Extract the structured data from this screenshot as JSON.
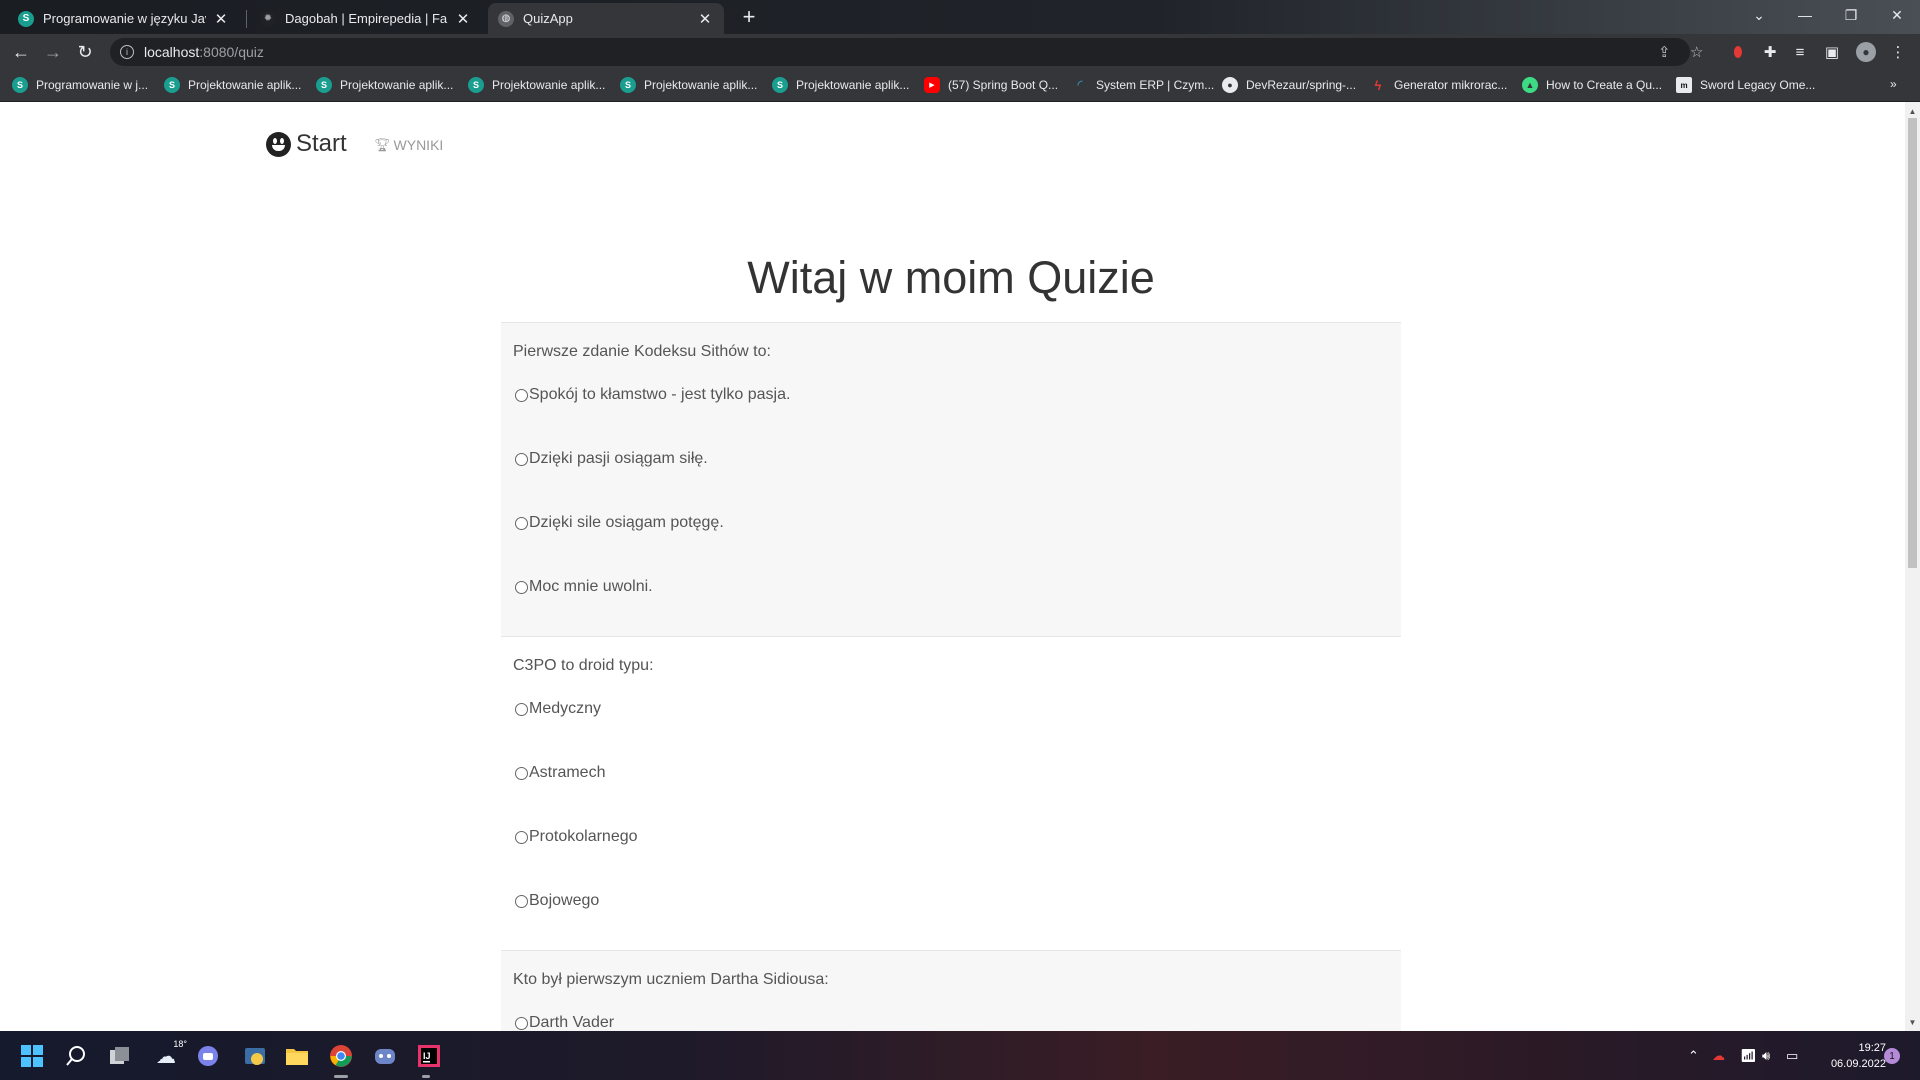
{
  "browser": {
    "tabs": [
      {
        "title": "Programowanie w języku Java [I]",
        "favicon": "s-favicon",
        "active": false
      },
      {
        "title": "Dagobah | Empirepedia | Fandom",
        "favicon": "fandom-favicon",
        "active": false
      },
      {
        "title": "QuizApp",
        "favicon": "globe-favicon",
        "active": true
      }
    ],
    "url_host": "localhost",
    "url_path": ":8080/quiz",
    "bookmarks": [
      {
        "label": "Programowanie w j...",
        "icon": "s-favicon"
      },
      {
        "label": "Projektowanie aplik...",
        "icon": "s-favicon"
      },
      {
        "label": "Projektowanie aplik...",
        "icon": "s-favicon"
      },
      {
        "label": "Projektowanie aplik...",
        "icon": "s-favicon"
      },
      {
        "label": "Projektowanie aplik...",
        "icon": "s-favicon"
      },
      {
        "label": "Projektowanie aplik...",
        "icon": "s-favicon"
      },
      {
        "label": "(57) Spring Boot Q...",
        "icon": "youtube-favicon"
      },
      {
        "label": "System ERP | Czym...",
        "icon": "loader-favicon"
      },
      {
        "label": "DevRezaur/spring-...",
        "icon": "github-favicon"
      },
      {
        "label": "Generator mikrorac...",
        "icon": "generator-favicon"
      },
      {
        "label": "How to Create a Qu...",
        "icon": "android-favicon"
      },
      {
        "label": "Sword Legacy Ome...",
        "icon": "ml-favicon"
      }
    ]
  },
  "page": {
    "brand": "Start",
    "nav_results": "WYNIKI",
    "title": "Witaj w moim Quizie",
    "questions": [
      {
        "text": "Pierwsze zdanie Kodeksu Sithów to:",
        "options": [
          "Spokój to kłamstwo - jest tylko pasja.",
          "Dzięki pasji osiągam siłę.",
          "Dzięki sile osiągam potęgę.",
          "Moc mnie uwolni."
        ]
      },
      {
        "text": "C3PO to droid typu:",
        "options": [
          "Medyczny",
          "Astramech",
          "Protokolarnego",
          "Bojowego"
        ]
      },
      {
        "text": "Kto był pierwszym uczniem Dartha Sidiousa:",
        "options": [
          "Darth Vader"
        ]
      }
    ]
  },
  "taskbar": {
    "weather": "18°",
    "time": "19:27",
    "date": "06.09.2022",
    "notifications": "1"
  },
  "colors": {
    "chrome_dark": "#35363a",
    "page_bg": "#ffffff",
    "question_bg": "#f7f7f7",
    "text": "#555555",
    "title": "#333333"
  }
}
